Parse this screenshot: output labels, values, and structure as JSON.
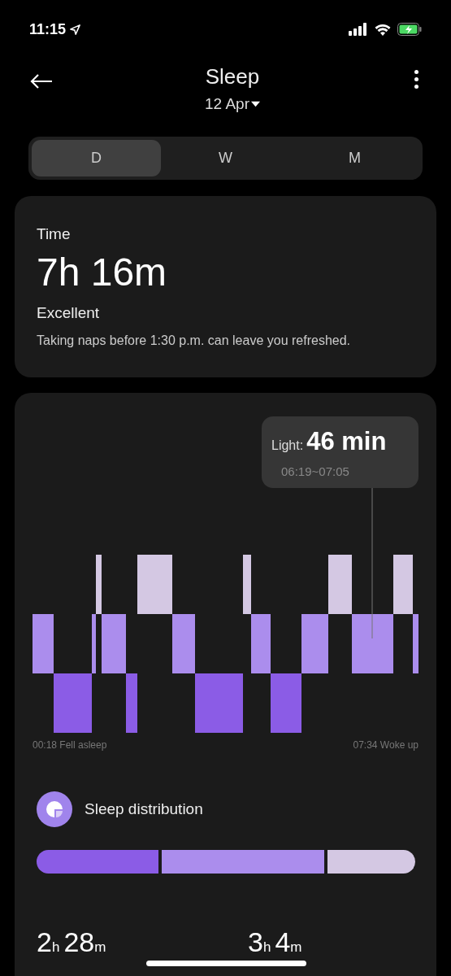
{
  "status_bar": {
    "time": "11:15"
  },
  "header": {
    "title": "Sleep",
    "date": "12 Apr"
  },
  "tabs": [
    {
      "label": "D",
      "selected": true
    },
    {
      "label": "W",
      "selected": false
    },
    {
      "label": "M",
      "selected": false
    }
  ],
  "summary": {
    "label": "Time",
    "value": "7h 16m",
    "rating": "Excellent",
    "tip": "Taking naps before 1:30 p.m. can leave you refreshed."
  },
  "hypnogram": {
    "tooltip": {
      "stage": "Light:",
      "duration": "46 min",
      "range": "06:19~07:05"
    },
    "start": "00:18 Fell asleep",
    "end": "07:34 Woke up"
  },
  "distribution": {
    "title": "Sleep distribution",
    "segments": [
      {
        "color": "#8b5ce6"
      },
      {
        "color": "#ab8ded"
      },
      {
        "color": "#d4c8e3"
      }
    ],
    "stats": [
      {
        "parts": [
          {
            "number": "2",
            "unit": "h"
          },
          {
            "number": "28",
            "unit": "m"
          }
        ]
      },
      {
        "parts": [
          {
            "number": "3",
            "unit": "h"
          },
          {
            "number": "4",
            "unit": "m"
          }
        ]
      }
    ]
  }
}
